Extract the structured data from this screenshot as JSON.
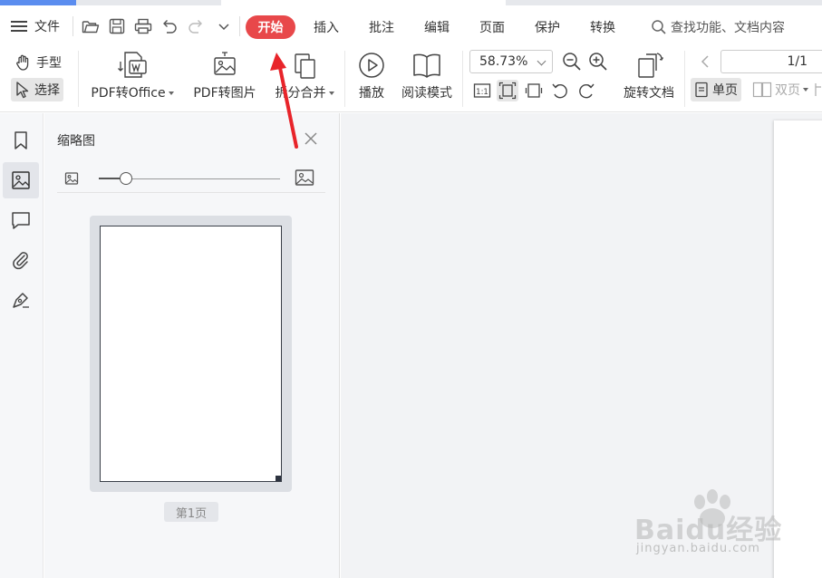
{
  "menu": {
    "file_label": "文件",
    "tabs": [
      "开始",
      "插入",
      "批注",
      "编辑",
      "页面",
      "保护",
      "转换"
    ],
    "active_tab": "开始",
    "search_label": "查找功能、文档内容"
  },
  "ribbon": {
    "hand_tool": "手型",
    "select_tool": "选择",
    "pdf_to_office": "PDF转Office",
    "pdf_to_image": "PDF转图片",
    "split_merge": "拆分合并",
    "play": "播放",
    "read_mode": "阅读模式",
    "zoom_value": "58.73%",
    "rotate_doc": "旋转文档",
    "page_value": "1/1",
    "single_page": "单页",
    "double_page": "双页"
  },
  "rail": {
    "items": [
      "bookmark-icon",
      "thumbnail-icon",
      "comment-icon",
      "attachment-icon",
      "signature-icon"
    ]
  },
  "thumbnail_panel": {
    "title": "缩略图",
    "size_slider_value": 0.15,
    "page_label": "第1页"
  },
  "annotation": {
    "arrow_color": "#e8242a"
  },
  "watermark": {
    "brand": "Baidu经验",
    "url": "jingyan.baidu.com"
  },
  "colors": {
    "active_tab_bg": "#e8484a",
    "accent_tab": "#5b8def"
  }
}
